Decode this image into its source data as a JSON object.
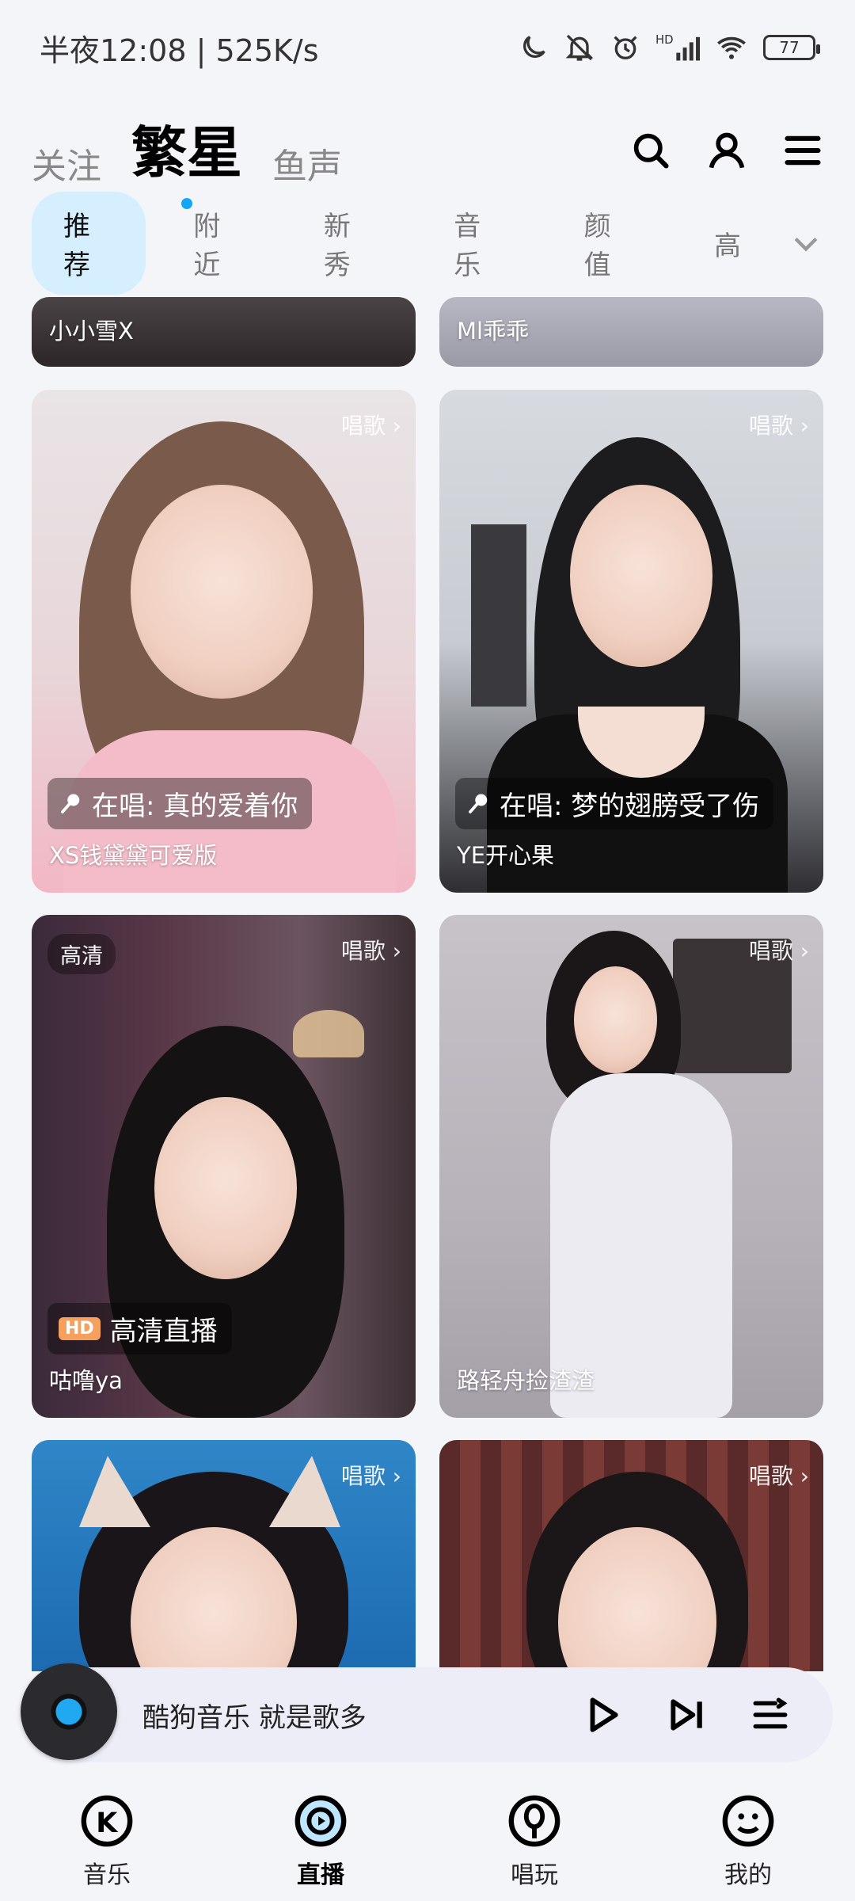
{
  "status_bar": {
    "time_speed": "半夜12:08 | 525K/s",
    "battery": "77",
    "icons": [
      "moon-icon",
      "mute-bell-icon",
      "alarm-icon",
      "hd-signal-icon",
      "wifi-icon",
      "battery-icon"
    ]
  },
  "top_nav": {
    "tabs": [
      {
        "label": "关注",
        "active": false
      },
      {
        "label": "繁星",
        "active": true
      },
      {
        "label": "鱼声",
        "active": false
      }
    ],
    "actions": [
      "search-icon",
      "profile-icon",
      "menu-icon"
    ]
  },
  "sub_categories": {
    "items": [
      "推荐",
      "附近",
      "新秀",
      "音乐",
      "颜值",
      "高"
    ],
    "active_index": 0
  },
  "feed": {
    "cards": [
      {
        "name": "小小雪X",
        "tag_top": "",
        "status": "",
        "hd_tag": ""
      },
      {
        "name": "Ml乖乖",
        "tag_top": "",
        "status": "",
        "hd_tag": ""
      },
      {
        "name": "XS钱黛黛可爱版",
        "tag_top": "唱歌 ›",
        "status": "在唱: 真的爱着你",
        "hd_tag": ""
      },
      {
        "name": "YE开心果",
        "tag_top": "唱歌 ›",
        "status": "在唱: 梦的翅膀受了伤",
        "hd_tag": ""
      },
      {
        "name": "咕噜ya",
        "tag_top": "唱歌 ›",
        "status": "高清直播",
        "hd_badge": "HD",
        "hd_tag": "高清"
      },
      {
        "name": "路轻舟捡渣渣",
        "tag_top": "唱歌 ›",
        "status": "",
        "hd_tag": ""
      },
      {
        "name": "",
        "tag_top": "唱歌 ›",
        "status": "",
        "hd_tag": ""
      },
      {
        "name": "",
        "tag_top": "唱歌 ›",
        "status": "",
        "hd_tag": ""
      }
    ]
  },
  "player": {
    "title": "酷狗音乐  就是歌多"
  },
  "bottom_nav": {
    "items": [
      {
        "label": "音乐",
        "icon": "kugou-music-icon",
        "active": false
      },
      {
        "label": "直播",
        "icon": "live-icon",
        "active": true
      },
      {
        "label": "唱玩",
        "icon": "sing-icon",
        "active": false
      },
      {
        "label": "我的",
        "icon": "me-icon",
        "active": false
      }
    ]
  },
  "colors": {
    "accent": "#12a8f5",
    "active_chip_bg": "#d6efff",
    "background": "#f4f5f9"
  }
}
